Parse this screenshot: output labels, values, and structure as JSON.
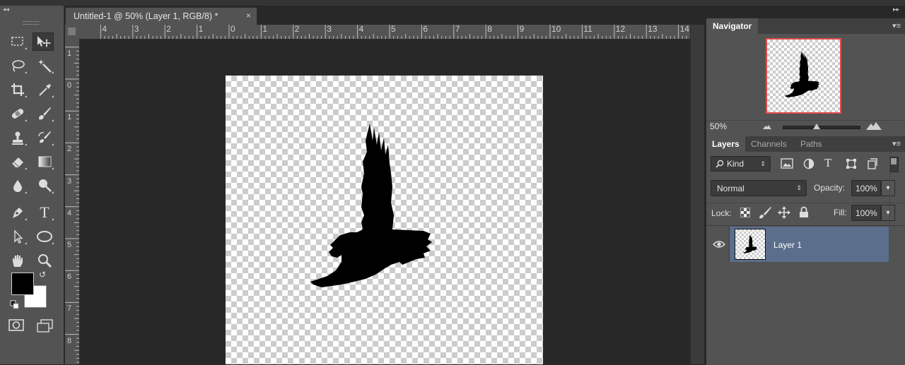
{
  "document": {
    "tab_title": "Untitled-1 @ 50% (Layer 1, RGB/8) *",
    "close_glyph": "×"
  },
  "rulers": {
    "top_labels": [
      "4",
      "3",
      "2",
      "1",
      "0",
      "1",
      "2",
      "3",
      "4",
      "5",
      "6",
      "7",
      "8",
      "9",
      "10",
      "11",
      "12",
      "13",
      "14"
    ],
    "left_labels": [
      "1",
      "0",
      "1",
      "2",
      "3",
      "4",
      "5",
      "6",
      "7",
      "8"
    ]
  },
  "tools": {
    "collapse_glyph": "◂◂",
    "items": [
      {
        "name": "rectangular-marquee-tool",
        "icon": "marquee-icon"
      },
      {
        "name": "move-tool",
        "icon": "move-icon",
        "active": true
      },
      {
        "name": "lasso-tool",
        "icon": "lasso-icon"
      },
      {
        "name": "magic-wand-tool",
        "icon": "magic-wand-icon"
      },
      {
        "name": "crop-tool",
        "icon": "crop-icon"
      },
      {
        "name": "eyedropper-tool",
        "icon": "eyedropper-icon"
      },
      {
        "name": "spot-healing-tool",
        "icon": "bandage-icon"
      },
      {
        "name": "brush-tool",
        "icon": "brush-icon"
      },
      {
        "name": "clone-stamp-tool",
        "icon": "stamp-icon"
      },
      {
        "name": "history-brush-tool",
        "icon": "history-brush-icon"
      },
      {
        "name": "eraser-tool",
        "icon": "eraser-icon"
      },
      {
        "name": "gradient-tool",
        "icon": "gradient-icon"
      },
      {
        "name": "blur-tool",
        "icon": "drop-icon"
      },
      {
        "name": "dodge-tool",
        "icon": "dodge-icon"
      },
      {
        "name": "pen-tool",
        "icon": "pen-icon"
      },
      {
        "name": "type-tool",
        "icon": "type-icon",
        "glyph": "T"
      },
      {
        "name": "path-selection-tool",
        "icon": "arrow-icon"
      },
      {
        "name": "ellipse-tool",
        "icon": "ellipse-icon"
      },
      {
        "name": "hand-tool",
        "icon": "hand-icon"
      },
      {
        "name": "zoom-tool",
        "icon": "zoom-icon"
      }
    ],
    "foreground_color": "#000000",
    "background_color": "#ffffff",
    "swap_glyph": "↺"
  },
  "navigator": {
    "tab_label": "Navigator",
    "zoom": "50%",
    "highlight_color": "#e04b4b"
  },
  "layers": {
    "tabs": [
      "Layers",
      "Channels",
      "Paths"
    ],
    "kind_label": "Kind",
    "filter_type_glyph": "T",
    "blend_mode": "Normal",
    "opacity_label": "Opacity:",
    "opacity_value": "100%",
    "lock_label": "Lock:",
    "fill_label": "Fill:",
    "fill_value": "100%",
    "items": [
      {
        "name": "Layer 1",
        "visible": true,
        "selected": true
      }
    ],
    "selected_color": "#5b6e8c"
  },
  "panel_menu_glyph": "▾≡"
}
